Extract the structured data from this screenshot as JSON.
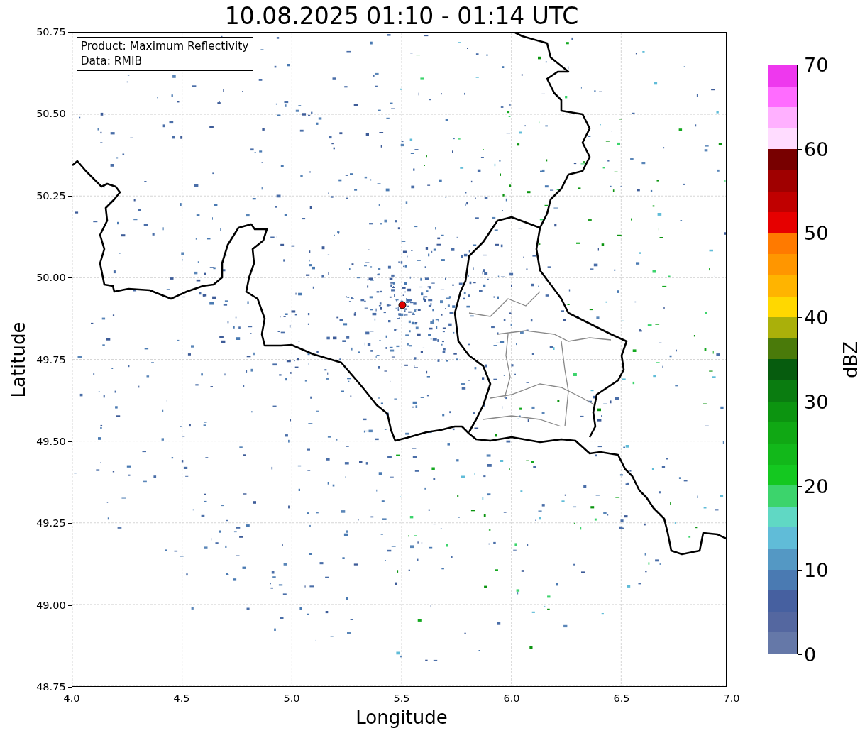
{
  "title": "10.08.2025 01:10 - 01:14 UTC",
  "info_box": {
    "lines": [
      "Product: Maximum Reflectivity",
      "Data: RMIB"
    ]
  },
  "x_axis": {
    "label": "Longitude",
    "ticks": [
      "4.0",
      "4.5",
      "5.0",
      "5.5",
      "6.0",
      "6.5",
      "7.0"
    ]
  },
  "y_axis": {
    "label": "Latitude",
    "ticks": [
      "50.75",
      "50.50",
      "50.25",
      "50.00",
      "49.75",
      "49.50",
      "49.25",
      "49.00",
      "48.75"
    ]
  },
  "colorbar": {
    "label": "dBZ",
    "ticks": [
      "70",
      "60",
      "50",
      "40",
      "30",
      "20",
      "10",
      "0"
    ],
    "bins": [
      {
        "color": "#6578a8"
      },
      {
        "color": "#5467a0"
      },
      {
        "color": "#4660a0"
      },
      {
        "color": "#4a7ab2"
      },
      {
        "color": "#5498c4"
      },
      {
        "color": "#60bcd8"
      },
      {
        "color": "#60d8c4"
      },
      {
        "color": "#3cd46c"
      },
      {
        "color": "#14c820"
      },
      {
        "color": "#12b81a"
      },
      {
        "color": "#10a814"
      },
      {
        "color": "#0c9410"
      },
      {
        "color": "#0a7c10"
      },
      {
        "color": "#065c0e"
      },
      {
        "color": "#4a7a0a"
      },
      {
        "color": "#aab00a"
      },
      {
        "color": "#ffd800"
      },
      {
        "color": "#ffb400"
      },
      {
        "color": "#ff9600"
      },
      {
        "color": "#ff7a00"
      },
      {
        "color": "#e60000"
      },
      {
        "color": "#c00000"
      },
      {
        "color": "#a00000"
      },
      {
        "color": "#780000"
      },
      {
        "color": "#ffdcff"
      },
      {
        "color": "#ffb0ff"
      },
      {
        "color": "#ff6cff"
      },
      {
        "color": "#ee38ee"
      }
    ]
  }
}
